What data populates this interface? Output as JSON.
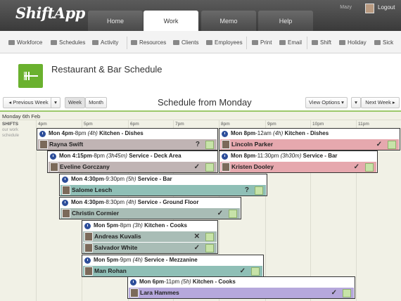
{
  "app": {
    "name": "ShiftApp",
    "user": "Mazy",
    "logout_label": "Logout"
  },
  "main_tabs": [
    {
      "label": "Home"
    },
    {
      "label": "Work"
    },
    {
      "label": "Memo"
    },
    {
      "label": "Help"
    }
  ],
  "toolbar": {
    "workforce": "Workforce",
    "schedules": "Schedules",
    "activity": "Activity",
    "resources": "Resources",
    "clients": "Clients",
    "employees": "Employees",
    "print": "Print",
    "email": "Email",
    "shift": "Shift",
    "holiday": "Holiday",
    "sick": "Sick"
  },
  "page": {
    "title": "Restaurant & Bar Schedule"
  },
  "nav": {
    "prev_week": "Previous Week",
    "week": "Week",
    "month": "Month",
    "schedule_title": "Schedule from Monday",
    "view_options": "View Options",
    "next_week": "Next Week"
  },
  "grid": {
    "day_label": "Monday 6th Feb",
    "shifts_heading": "SHIFTS",
    "shifts_sub": "our work schedule",
    "hours": [
      "4pm",
      "5pm",
      "6pm",
      "7pm",
      "8pm",
      "9pm",
      "10pm",
      "11pm"
    ]
  },
  "shifts": [
    {
      "day": "Mon",
      "start": "4pm",
      "end": "8pm",
      "dur": "(4h)",
      "title": "Kitchen - Dishes",
      "employees": [
        {
          "name": "Rayna Swift",
          "status": "?",
          "color": "#c0b4b4"
        }
      ]
    },
    {
      "day": "Mon",
      "start": "8pm",
      "end": "12am",
      "dur": "(4h)",
      "title": "Kitchen - Dishes",
      "employees": [
        {
          "name": "Lincoln Parker",
          "status": "✓",
          "color": "#e6a8ae"
        }
      ]
    },
    {
      "day": "Mon",
      "start": "4:15pm",
      "end": "8pm",
      "dur": "(3h45m)",
      "title": "Service - Deck Area",
      "employees": [
        {
          "name": "Eveline Gorczany",
          "status": "✓",
          "color": "#c0b4b4"
        }
      ]
    },
    {
      "day": "Mon",
      "start": "8pm",
      "end": "11:30pm",
      "dur": "(3h30m)",
      "title": "Service - Bar",
      "employees": [
        {
          "name": "Kristen Dooley",
          "status": "✓",
          "color": "#e6a8ae"
        }
      ]
    },
    {
      "day": "Mon",
      "start": "4:30pm",
      "end": "9:30pm",
      "dur": "(5h)",
      "title": "Service - Bar",
      "employees": [
        {
          "name": "Salome Lesch",
          "status": "?",
          "color": "#8fbfb6"
        }
      ]
    },
    {
      "day": "Mon",
      "start": "4:30pm",
      "end": "8:30pm",
      "dur": "(4h)",
      "title": "Service - Ground Floor",
      "employees": [
        {
          "name": "Christin Cormier",
          "status": "✓",
          "color": "#a9bdb6"
        }
      ]
    },
    {
      "day": "Mon",
      "start": "5pm",
      "end": "8pm",
      "dur": "(3h)",
      "title": "Kitchen - Cooks",
      "employees": [
        {
          "name": "Andreas Kuvalis",
          "status": "✕",
          "color": "#a9bdb6"
        },
        {
          "name": "Salvador White",
          "status": "✓",
          "color": "#a9bdb6"
        }
      ]
    },
    {
      "day": "Mon",
      "start": "5pm",
      "end": "9pm",
      "dur": "(4h)",
      "title": "Service - Mezzanine",
      "employees": [
        {
          "name": "Man Rohan",
          "status": "✓",
          "color": "#8fbfb6"
        }
      ]
    },
    {
      "day": "Mon",
      "start": "6pm",
      "end": "11pm",
      "dur": "(5h)",
      "title": "Kitchen - Cooks",
      "employees": [
        {
          "name": "Lara Hammes",
          "status": "✓",
          "color": "#b6a8dc"
        }
      ]
    }
  ]
}
